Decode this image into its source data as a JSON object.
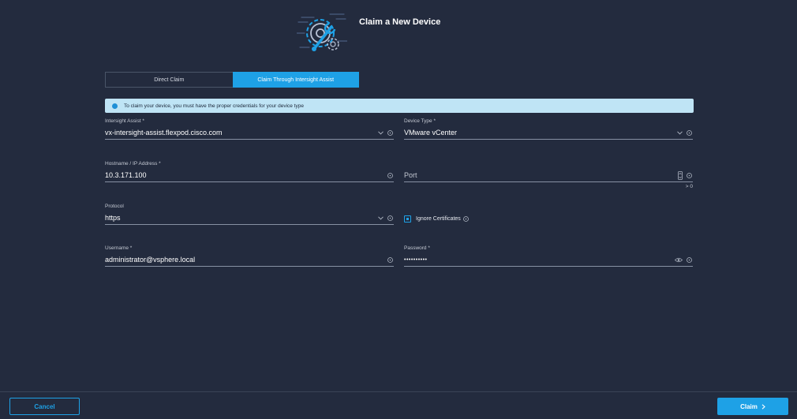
{
  "header": {
    "title": "Claim a New Device",
    "hero_icon": "gears-wrench-icon"
  },
  "tabs": [
    {
      "label": "Direct Claim",
      "active": false
    },
    {
      "label": "Claim Through Intersight Assist",
      "active": true
    }
  ],
  "banner": {
    "message": "To claim your device, you must have the proper credentials for your device type",
    "color": "#bfe4f5"
  },
  "form": {
    "intersight_assist": {
      "label": "Intersight Assist *",
      "value": "vx-intersight-assist.flexpod.cisco.com"
    },
    "device_type": {
      "label": "Device Type *",
      "value": "VMware vCenter"
    },
    "hostname": {
      "label": "Hostname / IP Address *",
      "value": "10.3.171.100"
    },
    "port": {
      "label": "",
      "placeholder": "Port",
      "hint": "> 0"
    },
    "protocol": {
      "label": "Protocol",
      "value": "https"
    },
    "ignore_certificates": {
      "label": "Ignore Certificates",
      "checked": true
    },
    "username": {
      "label": "Username *",
      "value": "administrator@vsphere.local"
    },
    "password": {
      "label": "Password *",
      "value": "••••••••••"
    }
  },
  "footer": {
    "cancel_label": "Cancel",
    "claim_label": "Claim"
  },
  "colors": {
    "accent": "#1ea1e6",
    "background": "#232b3e"
  }
}
